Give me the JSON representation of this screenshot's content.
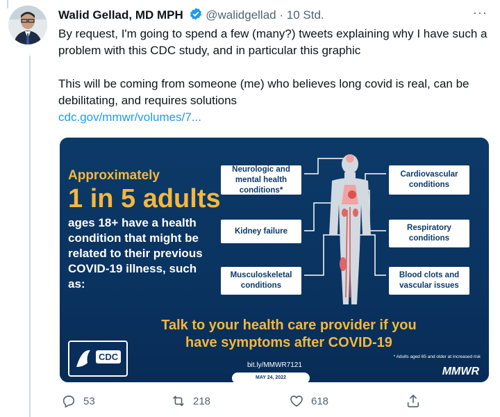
{
  "tweet": {
    "author_name": "Walid Gellad, MD MPH",
    "handle": "@walidgellad",
    "separator": "·",
    "time": "10 Std.",
    "more_label": "···",
    "paragraph_1": "By request, I'm going to spend a few (many?) tweets explaining why I have such a problem with this CDC study, and in particular this graphic",
    "paragraph_2": "This will be coming from someone (me) who believes long covid is real, can be debilitating, and requires solutions",
    "link": "cdc.gov/mmwr/volumes/7..."
  },
  "infographic": {
    "approx": "Approximately",
    "big": "1 in 5 adults",
    "ages": "ages 18+ have a health condition that might be related to their previous COVID-19 illness, such as:",
    "conditions_left": [
      "Neurologic and mental health conditions*",
      "Kidney failure",
      "Musculoskeletal conditions"
    ],
    "conditions_right": [
      "Cardiovascular conditions",
      "Respiratory conditions",
      "Blood clots and vascular issues"
    ],
    "cta": "Talk to your health care provider if you have symptoms after COVID-19",
    "cdc_logo": "CDC",
    "bitly": "bit.ly/MMWR7121",
    "date": "MAY 24, 2022",
    "footnote": "* Adults aged 65 and older at increased risk",
    "mmwr": "MMWR"
  },
  "actions": {
    "reply_count": "53",
    "retweet_count": "218",
    "like_count": "618"
  },
  "colors": {
    "accent": "#1d9bf0",
    "card_bg": "#0c3a68",
    "highlight": "#f6b73c"
  }
}
